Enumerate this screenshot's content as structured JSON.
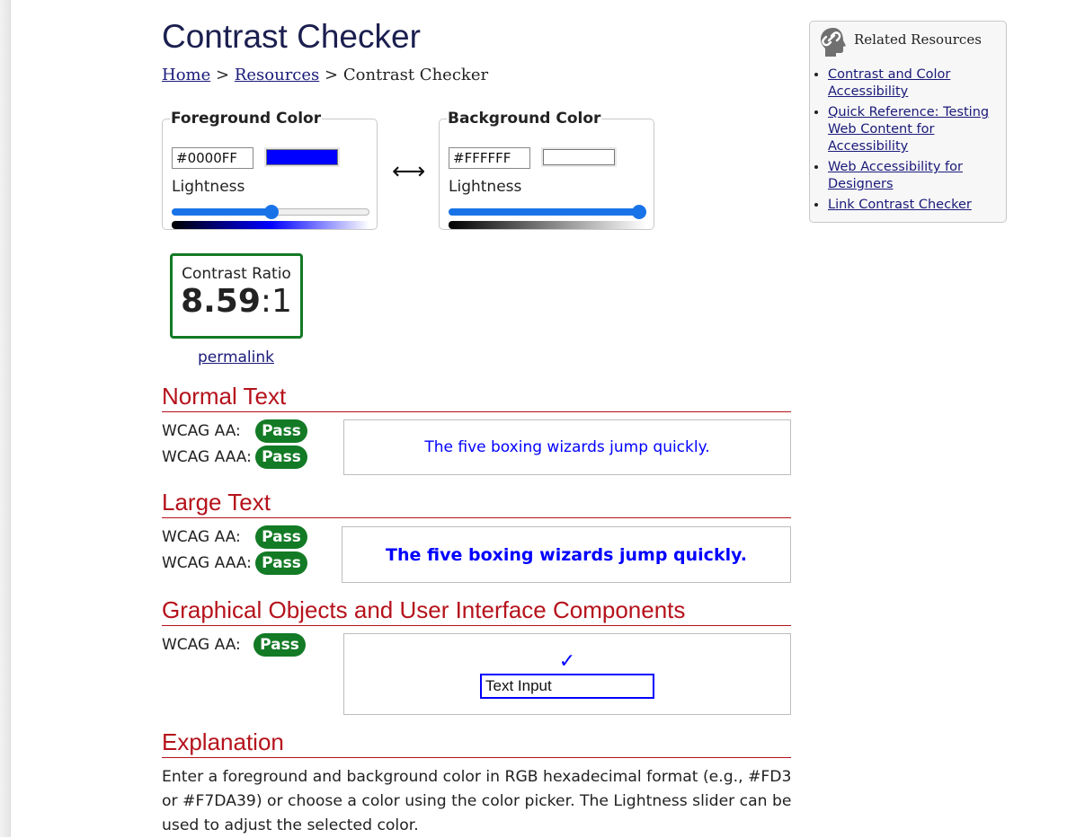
{
  "page": {
    "title": "Contrast Checker",
    "breadcrumb": {
      "home": "Home",
      "sep1": ">",
      "resources": "Resources",
      "sep2": ">",
      "current": "Contrast Checker"
    }
  },
  "foreground": {
    "legend": "Foreground Color",
    "hex": "#0000FF",
    "color": "#0000FF",
    "lightness_label": "Lightness",
    "lightness": 0.5
  },
  "background": {
    "legend": "Background Color",
    "hex": "#FFFFFF",
    "color": "#FFFFFF",
    "lightness_label": "Lightness",
    "lightness": 1.0
  },
  "swap_icon": "left-right-arrow-icon",
  "contrast": {
    "label": "Contrast Ratio",
    "value": "8.59",
    "suffix": ":1",
    "permalink": "permalink"
  },
  "sections": {
    "normal": {
      "heading": "Normal Text",
      "aa_label": "WCAG AA:",
      "aa_result": "Pass",
      "aaa_label": "WCAG AAA:",
      "aaa_result": "Pass",
      "sample": "The five boxing wizards jump quickly."
    },
    "large": {
      "heading": "Large Text",
      "aa_label": "WCAG AA:",
      "aa_result": "Pass",
      "aaa_label": "WCAG AAA:",
      "aaa_result": "Pass",
      "sample": "The five boxing wizards jump quickly."
    },
    "graphical": {
      "heading": "Graphical Objects and User Interface Components",
      "aa_label": "WCAG AA:",
      "aa_result": "Pass",
      "checkmark": "✓",
      "text_input": "Text Input"
    },
    "explanation": {
      "heading": "Explanation",
      "text": "Enter a foreground and background color in RGB hexadecimal format (e.g., #FD3 or #F7DA39) or choose a color using the color picker. The Lightness slider can be used to adjust the selected color."
    }
  },
  "related": {
    "title": "Related Resources",
    "items": [
      "Contrast and Color Accessibility",
      "Quick Reference: Testing Web Content for Accessibility",
      "Web Accessibility for Designers",
      "Link Contrast Checker"
    ]
  },
  "colors": {
    "pass": "#137A25",
    "heading": "#B5121B",
    "link": "#1A1A7A",
    "slider": "#1973E8"
  }
}
